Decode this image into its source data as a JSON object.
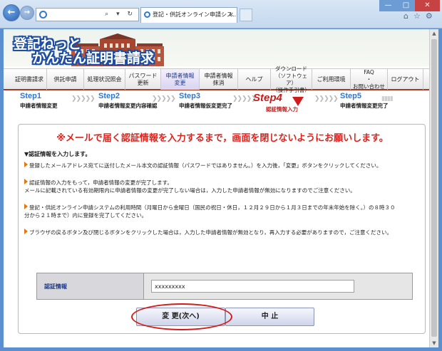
{
  "browser": {
    "tab_title": "登記・供託オンライン申請シス...",
    "address_tools": "⌕ ▾ ↻",
    "tab_close": "×",
    "win_min": "—",
    "win_max": "□",
    "win_close": "✕",
    "toolbar_icons": "⌂☆⚙"
  },
  "banner": {
    "line1": "登記ねっと",
    "line2": "かんたん証明書請求"
  },
  "menu": [
    {
      "label": "証明書請求"
    },
    {
      "label": "供託申請"
    },
    {
      "label": "処理状況照会"
    },
    {
      "label": "パスワード\n更新"
    },
    {
      "label": "申請者情報\n変更"
    },
    {
      "label": "申請者情報\n抹消"
    },
    {
      "label": "ヘルプ"
    },
    {
      "label": "ダウンロード\n（ソフトウェア）\n（操作手引書）"
    },
    {
      "label": "ご利用環境"
    },
    {
      "label": "FAQ\n・\nお問い合わせ"
    },
    {
      "label": "ログアウト"
    }
  ],
  "steps": [
    {
      "num": "Step1",
      "label": "申請者情報変更"
    },
    {
      "num": "Step2",
      "label": "申請者情報変更内容確認"
    },
    {
      "num": "Step3",
      "label": "申請者情報仮変更完了"
    },
    {
      "num": "Step4",
      "label": "認証情報入力"
    },
    {
      "num": "Step5",
      "label": "申請者情報変更完了"
    }
  ],
  "main": {
    "warning": "※メールで届く認証情報を入力するまで，画面を閉じないようにお願いします。",
    "section_title": "▼認証情報を入力します。",
    "bullets": [
      "登録したメールアドレス宛てに送付したメール本文の認証情報（パスワードではありません。）を入力後，「変更」ボタンをクリックしてください。",
      "認証情報の入力をもって，申請者情報の変更が完了します。\nメールに記載されている有効期限内に申請者情報の変更が完了しない場合は，入力した申請者情報が無効になりますのでご注意ください。",
      "登記・供託オンライン申請システムの利用時間（月曜日から金曜日（国民の祝日・休日，１２月２９日から１月３日までの年末年始を除く。）の８時３０\n分から２１時まで）内に登録を完了してください。",
      "ブラウザの戻るボタン及び閉じるボタンをクリックした場合は，入力した申請者情報が無効となり，再入力する必要がありますので，ご注意ください。"
    ],
    "form_label": "認証情報",
    "form_value": "xxxxxxxxx",
    "ok_button": "変 更(次へ)",
    "cancel_button": "中 止"
  },
  "colors": {
    "accent_red": "#e0211b",
    "step_blue": "#2b77d6",
    "logo_blue": "#1c4da3"
  }
}
